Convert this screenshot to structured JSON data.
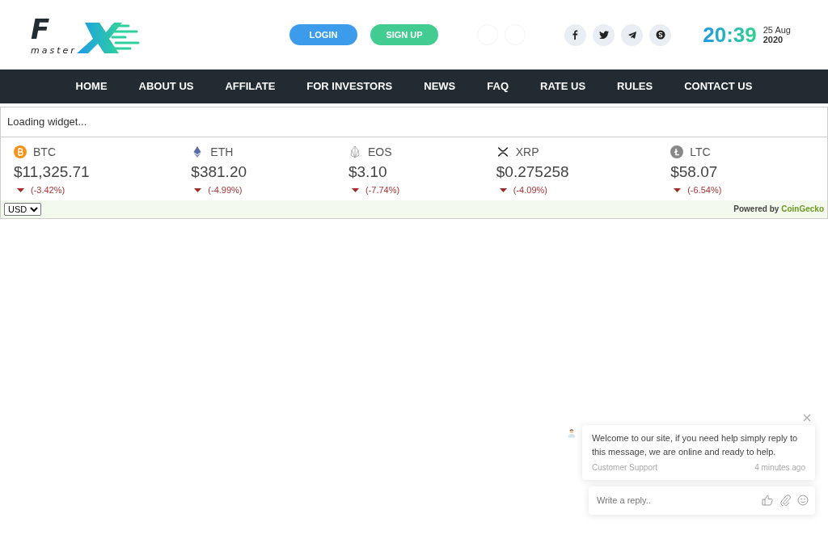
{
  "logo": {
    "letter": "F",
    "word": "master"
  },
  "auth_buttons": [
    {
      "label": "LOGIN",
      "kind": "login"
    },
    {
      "label": "SIGN UP",
      "kind": "signup"
    }
  ],
  "social": [
    {
      "kind": "facebook"
    },
    {
      "kind": "twitter"
    },
    {
      "kind": "telegram"
    },
    {
      "kind": "skype"
    }
  ],
  "clock": {
    "time": "20:39",
    "date": "25 Aug",
    "year": "2020"
  },
  "nav": [
    "HOME",
    "ABOUT US",
    "AFFILATE",
    "FOR INVESTORS",
    "NEWS",
    "FAQ",
    "RATE US",
    "RULES",
    "CONTACT US"
  ],
  "widget": {
    "loading": "Loading widget...",
    "coins": [
      {
        "kind": "btc",
        "symbol": "BTC",
        "price": "$11,325.71",
        "change": "(-3.42%)",
        "falling": true
      },
      {
        "kind": "eth",
        "symbol": "ETH",
        "price": "$381.20",
        "change": "(-4.99%)",
        "falling": true
      },
      {
        "kind": "eos",
        "symbol": "EOS",
        "price": "$3.10",
        "change": "(-7.74%)",
        "falling": true
      },
      {
        "kind": "xrp",
        "symbol": "XRP",
        "price": "$0.275258",
        "change": "(-4.09%)",
        "falling": true
      },
      {
        "kind": "ltc",
        "symbol": "LTC",
        "price": "$58.07",
        "change": "(-6.54%)",
        "falling": true
      }
    ],
    "currency": "USD",
    "powered_by": "Powered by",
    "provider": "CoinGecko"
  },
  "chat": {
    "message": "Welcome to our site, if you need help simply reply to this message, we are online and ready to help.",
    "author": "Customer Support",
    "time": "4 minutes ago",
    "reply_placeholder": "Write a reply.."
  }
}
